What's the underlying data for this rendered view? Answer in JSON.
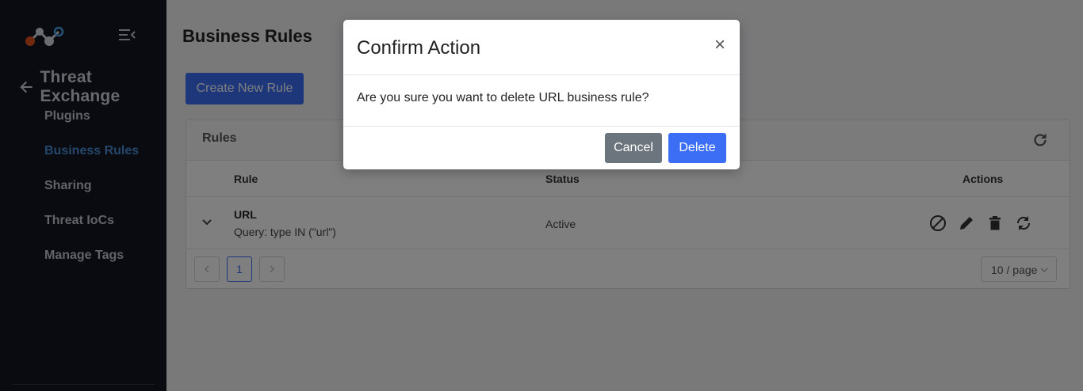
{
  "sidebar": {
    "section_title": "Threat Exchange",
    "items": [
      {
        "label": "Plugins",
        "active": false
      },
      {
        "label": "Business Rules",
        "active": true
      },
      {
        "label": "Sharing",
        "active": false
      },
      {
        "label": "Threat IoCs",
        "active": false
      },
      {
        "label": "Manage Tags",
        "active": false
      }
    ]
  },
  "main": {
    "page_title": "Business Rules",
    "create_button": "Create New Rule",
    "card_title": "Rules",
    "columns": {
      "rule": "Rule",
      "status": "Status",
      "actions": "Actions"
    },
    "rows": [
      {
        "name": "URL",
        "query": "Query: type IN (\"url\")",
        "status": "Active"
      }
    ],
    "pagination": {
      "current_page": "1",
      "page_size": "10 / page"
    }
  },
  "modal": {
    "title": "Confirm Action",
    "close": "×",
    "message": "Are you sure you want to delete URL business rule?",
    "cancel_label": "Cancel",
    "delete_label": "Delete"
  },
  "colors": {
    "sidebar_bg": "#141720",
    "accent": "#3b6ef5",
    "active_nav": "#4a8fd6",
    "cancel_button": "#6c757d"
  },
  "icons": [
    "app-logo-icon",
    "menu-collapse-icon",
    "arrow-left-icon",
    "refresh-icon",
    "chevron-down-icon",
    "disable-icon",
    "edit-pencil-icon",
    "trash-icon",
    "sync-icon",
    "chevron-left-icon",
    "chevron-right-icon"
  ]
}
